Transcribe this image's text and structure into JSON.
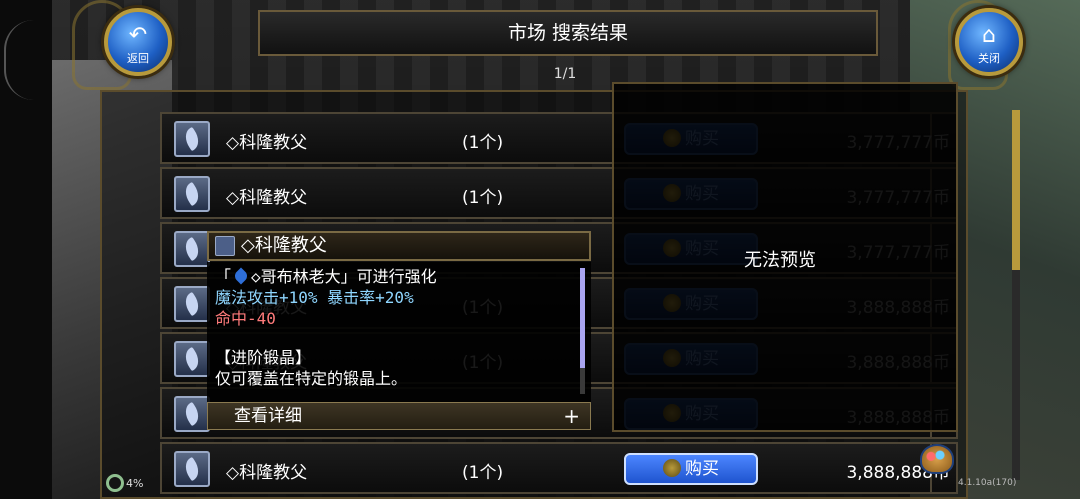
{
  "header": {
    "title": "市场  搜索结果",
    "page_indicator": "1/1",
    "back_label": "返回",
    "close_label": "关闭"
  },
  "listings": [
    {
      "name": "◇科隆教父",
      "qty": "(1个)",
      "buy": "购买",
      "price": "3,777,777币",
      "active": false
    },
    {
      "name": "◇科隆教父",
      "qty": "(1个)",
      "buy": "购买",
      "price": "3,777,777币",
      "active": false
    },
    {
      "name": "◇科隆教父",
      "qty": "(1个)",
      "buy": "购买",
      "price": "3,777,777币",
      "active": false
    },
    {
      "name": "◇科隆教父",
      "qty": "(1个)",
      "buy": "购买",
      "price": "3,888,888币",
      "active": false
    },
    {
      "name": "◇科隆教父",
      "qty": "(1个)",
      "buy": "购买",
      "price": "3,888,888币",
      "active": false
    },
    {
      "name": "◇科隆教父",
      "qty": "(1个)",
      "buy": "购买",
      "price": "3,888,888币",
      "active": false
    },
    {
      "name": "◇科隆教父",
      "qty": "(1个)",
      "buy": "购买",
      "price": "3,888,888币",
      "active": true
    }
  ],
  "preview": {
    "message": "无法预览"
  },
  "tooltip": {
    "title": "◇科隆教父",
    "line1_prefix": "「",
    "line1_suffix": "◇哥布林老大」可进行强化",
    "line2": "魔法攻击+10% 暴击率+20%",
    "line3": "命中-40",
    "line4": "【进阶锻晶】",
    "line5": "仅可覆盖在特定的锻晶上。",
    "footer": "查看详细",
    "footer_plus": "+"
  },
  "hud": {
    "battery": "4%",
    "version": "4.1.10a(170)"
  },
  "colors": {
    "buy_active": "#4c86ff",
    "frame_gold": "#b89a3c",
    "stat_blue": "#8fd6ff",
    "stat_red": "#ff7b7b"
  }
}
